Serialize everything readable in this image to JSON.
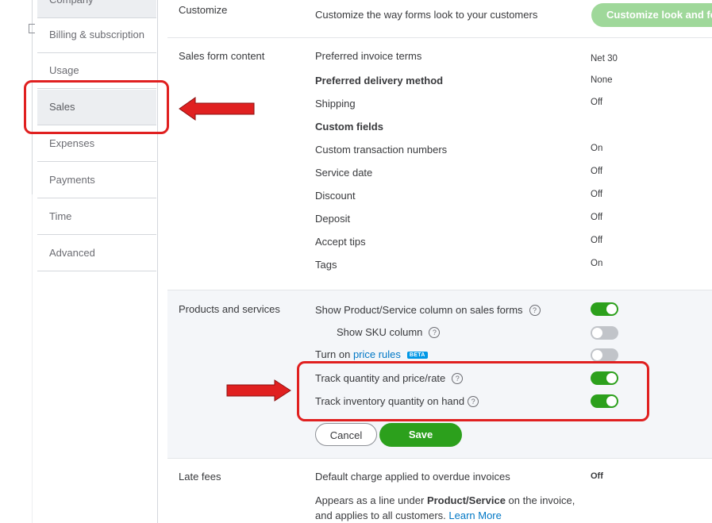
{
  "sidebar": {
    "items": [
      {
        "label": "Company"
      },
      {
        "label": "Billing & subscription"
      },
      {
        "label": "Usage"
      },
      {
        "label": "Sales"
      },
      {
        "label": "Expenses"
      },
      {
        "label": "Payments"
      },
      {
        "label": "Time"
      },
      {
        "label": "Advanced"
      }
    ],
    "active": "Sales"
  },
  "customize": {
    "title": "Customize",
    "description": "Customize the way forms look to your customers",
    "button_label": "Customize look and feel"
  },
  "sales_form_content": {
    "title": "Sales form content",
    "rows": [
      {
        "label": "Preferred invoice terms",
        "value": "Net 30"
      },
      {
        "label": "Preferred delivery method",
        "value": "None"
      },
      {
        "label": "Shipping",
        "value": "Off"
      },
      {
        "label": "Custom fields",
        "value": ""
      },
      {
        "label": "Custom transaction numbers",
        "value": "On"
      },
      {
        "label": "Service date",
        "value": "Off"
      },
      {
        "label": "Discount",
        "value": "Off"
      },
      {
        "label": "Deposit",
        "value": "Off"
      },
      {
        "label": "Accept tips",
        "value": "Off"
      },
      {
        "label": "Tags",
        "value": "On"
      }
    ]
  },
  "products_services": {
    "title": "Products and services",
    "rows": [
      {
        "label": "Show Product/Service column on sales forms",
        "on": true
      },
      {
        "label": "Show SKU column",
        "on": false
      },
      {
        "label_prefix": "Turn on ",
        "link": "price rules",
        "badge": "BETA",
        "on": false
      },
      {
        "label": "Track quantity and price/rate",
        "on": true
      },
      {
        "label": "Track inventory quantity on hand",
        "on": true
      }
    ],
    "help_glyph": "?",
    "cancel_label": "Cancel",
    "save_label": "Save"
  },
  "late_fees": {
    "title": "Late fees",
    "label": "Default charge applied to overdue invoices",
    "value": "Off",
    "note_part1": "Appears as a line under ",
    "note_bold": "Product/Service",
    "note_part2": " on the invoice,",
    "note_line2": "and applies to all customers. ",
    "learn_more": "Learn More"
  },
  "colors": {
    "accent_green": "#2ca01c",
    "disabled_green": "#9fd89a",
    "annotation_red": "#e02020",
    "link_blue": "#0077c5"
  }
}
